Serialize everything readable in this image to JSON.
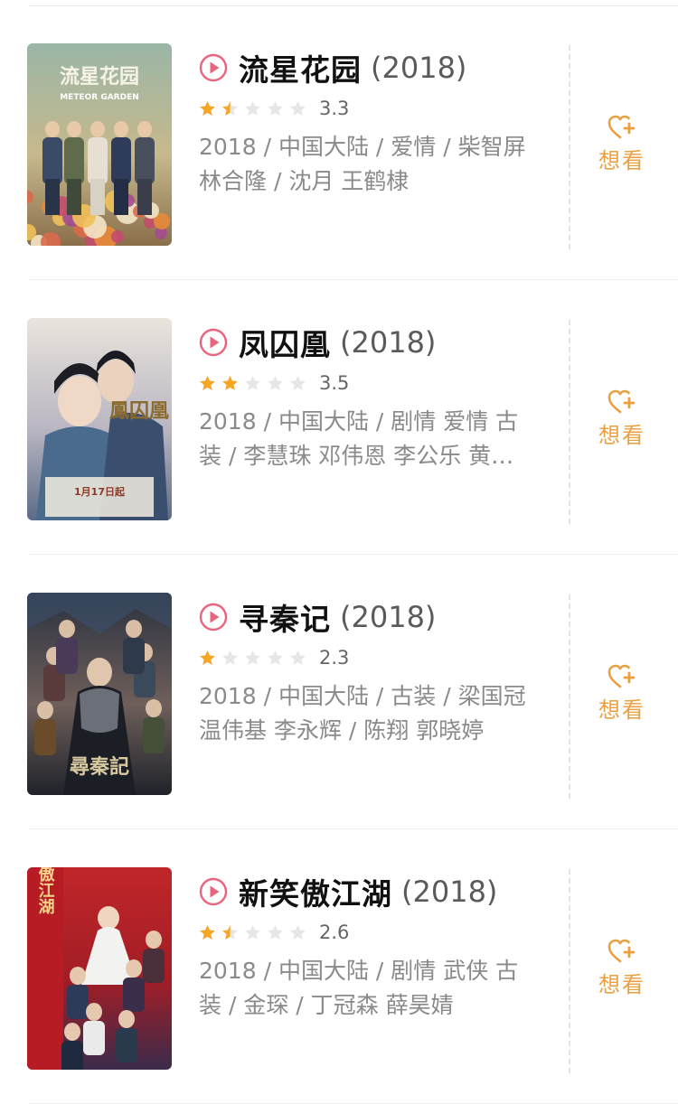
{
  "movies": [
    {
      "title": "流星花园",
      "year": "(2018)",
      "score": "3.3",
      "stars": [
        1,
        0.5,
        0,
        0,
        0
      ],
      "meta": "2018 / 中国大陆 / 爱情 / 柴智屏 林合隆 / 沈月 王鹤棣",
      "want_label": "想看",
      "poster_text": "流星花园",
      "poster_subtext": "METEOR GARDEN"
    },
    {
      "title": "凤囚凰",
      "year": "(2018)",
      "score": "3.5",
      "stars": [
        1,
        1,
        0,
        0,
        0
      ],
      "meta": "2018 / 中国大陆 / 剧情 爱情 古装 / 李慧珠 邓伟恩 李公乐 黄…",
      "want_label": "想看",
      "poster_text": "鳳囚凰",
      "poster_subtext": "1月17日起"
    },
    {
      "title": "寻秦记",
      "year": "(2018)",
      "score": "2.3",
      "stars": [
        1,
        0,
        0,
        0,
        0
      ],
      "meta": "2018 / 中国大陆 / 古装 / 梁国冠 温伟基 李永辉 / 陈翔 郭晓婷",
      "want_label": "想看",
      "poster_text": "尋秦記",
      "poster_subtext": ""
    },
    {
      "title": "新笑傲江湖",
      "year": "(2018)",
      "score": "2.6",
      "stars": [
        1,
        0.5,
        0,
        0,
        0
      ],
      "meta": "2018 / 中国大陆 / 剧情 武侠 古装 / 金琛 / 丁冠森 薛昊婧",
      "want_label": "想看",
      "poster_text": "笑傲江湖",
      "poster_subtext": ""
    }
  ],
  "colors": {
    "star_filled": "#f5a623",
    "star_empty": "#e6e6e6",
    "play_icon": "#e8657e",
    "want_accent": "#e9a040"
  },
  "icons": {
    "play": "play-circle-icon",
    "star": "star-icon",
    "want": "heart-plus-icon"
  }
}
